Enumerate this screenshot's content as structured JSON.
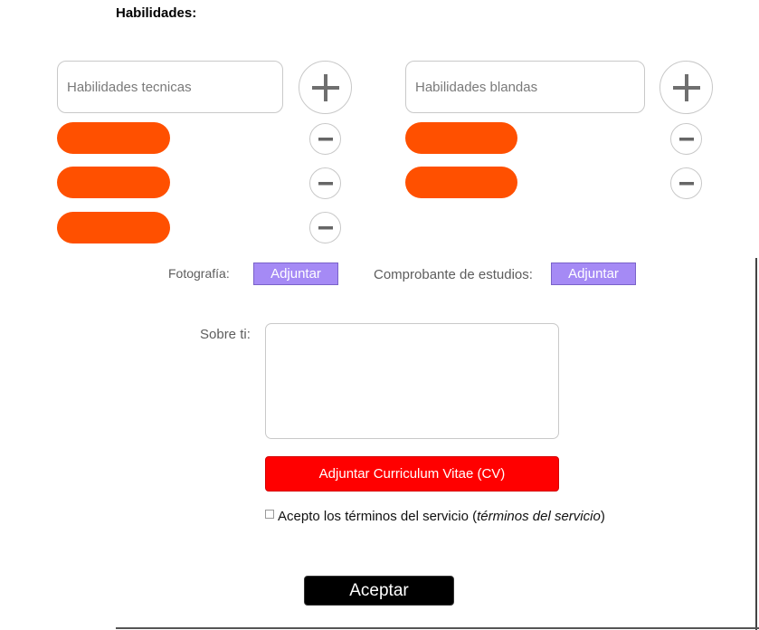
{
  "section": {
    "title": "Habilidades:"
  },
  "technical": {
    "placeholder": "Habilidades tecnicas",
    "items": [
      "",
      "",
      ""
    ]
  },
  "soft": {
    "placeholder": "Habilidades blandas",
    "items": [
      "",
      ""
    ]
  },
  "attachments": {
    "photo_label": "Fotografía:",
    "photo_button": "Adjuntar",
    "studies_label": "Comprobante de estudios:",
    "studies_button": "Adjuntar"
  },
  "about": {
    "label": "Sobre ti:",
    "value": ""
  },
  "cv_button": "Adjuntar Curriculum Vitae (CV)",
  "terms": {
    "checked": false,
    "text": "Acepto los términos del servicio (",
    "link": "términos del servicio",
    "close": ")"
  },
  "accept_button": "Aceptar",
  "colors": {
    "pill": "#ff5000",
    "attach": "#a58af5",
    "cv": "#ff0000",
    "accept": "#000000"
  },
  "icons": {
    "add": "plus-icon",
    "remove": "minus-icon"
  }
}
